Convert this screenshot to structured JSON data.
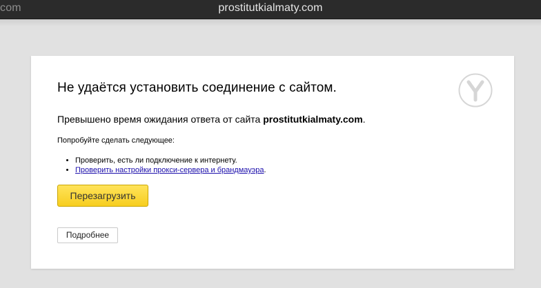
{
  "topbar": {
    "left_text": "com",
    "title": "prostitutkialmaty.com"
  },
  "error": {
    "heading": "Не удаётся установить соединение с сайтом.",
    "desc_prefix": "Превышено время ожидания ответа от сайта ",
    "desc_site": "prostitutkialmaty.com",
    "desc_suffix": ".",
    "try_text": "Попробуйте сделать следующее:",
    "suggestion_1": "Проверить, есть ли подключение к интернету.",
    "suggestion_2_link": "Проверить настройки прокси-сервера и брандмауэра",
    "suggestion_2_suffix": ".",
    "reload_label": "Перезагрузить",
    "details_label": "Подробнее"
  },
  "logo": {
    "icon": "yandex-browser-logo-icon"
  },
  "colors": {
    "reload_button": "#f7ce1f",
    "link": "#1a0dab",
    "page_bg": "#e1e1e1",
    "topbar_bg": "#2b2b2b"
  }
}
